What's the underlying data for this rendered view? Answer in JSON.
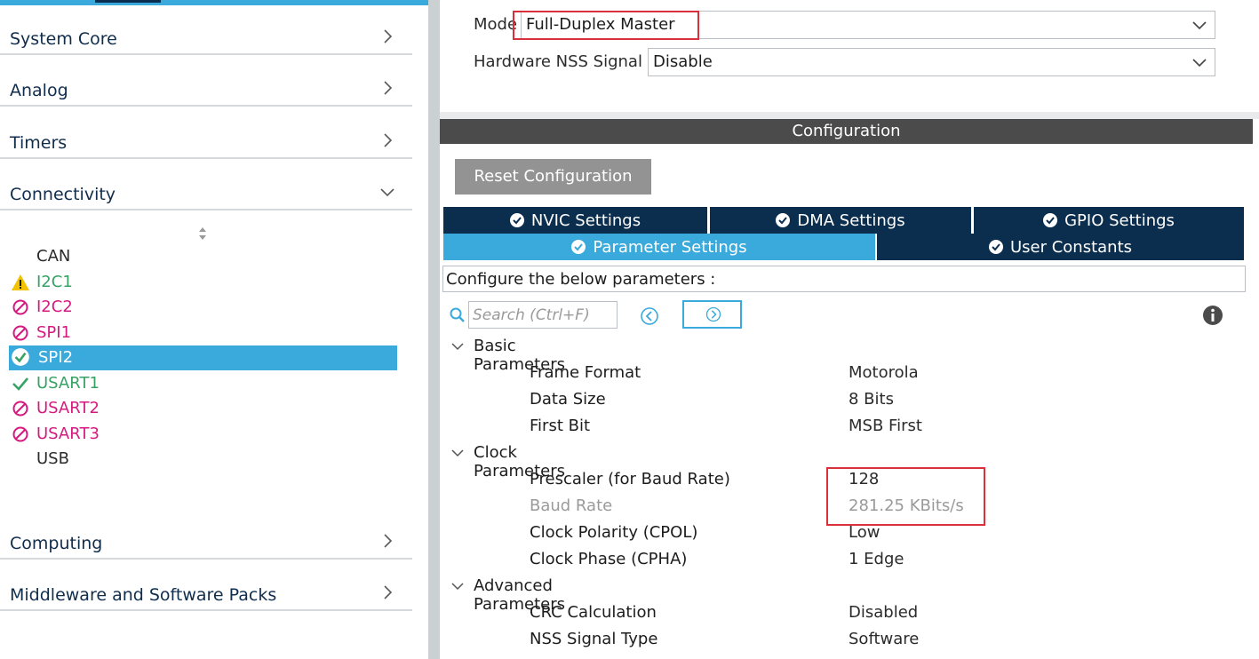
{
  "sidebar": {
    "categories": [
      {
        "label": "System Core"
      },
      {
        "label": "Analog"
      },
      {
        "label": "Timers"
      },
      {
        "label": "Connectivity"
      },
      {
        "label": "Computing"
      },
      {
        "label": "Middleware and Software Packs"
      }
    ],
    "peripherals": [
      {
        "label": "CAN",
        "status": "none"
      },
      {
        "label": "I2C1",
        "status": "warning"
      },
      {
        "label": "I2C2",
        "status": "disabled"
      },
      {
        "label": "SPI1",
        "status": "disabled"
      },
      {
        "label": "SPI2",
        "status": "selected"
      },
      {
        "label": "USART1",
        "status": "ok"
      },
      {
        "label": "USART2",
        "status": "disabled"
      },
      {
        "label": "USART3",
        "status": "disabled"
      },
      {
        "label": "USB",
        "status": "none"
      }
    ]
  },
  "mode": {
    "mode_label": "Mode",
    "mode_value": "Full-Duplex Master",
    "nss_label": "Hardware NSS Signal",
    "nss_value": "Disable"
  },
  "configuration": {
    "header": "Configuration",
    "reset_label": "Reset Configuration",
    "tabs": [
      {
        "label": "NVIC Settings",
        "active": false
      },
      {
        "label": "DMA Settings",
        "active": false
      },
      {
        "label": "GPIO Settings",
        "active": false
      },
      {
        "label": "Parameter Settings",
        "active": true
      },
      {
        "label": "User Constants",
        "active": false
      }
    ],
    "caption": "Configure the below parameters :",
    "search_placeholder": "Search (Ctrl+F)"
  },
  "parameters": {
    "groups": [
      {
        "label": "Basic Parameters"
      },
      {
        "label": "Clock Parameters"
      },
      {
        "label": "Advanced Parameters"
      }
    ],
    "rows": [
      {
        "name": "Frame Format",
        "value": "Motorola"
      },
      {
        "name": "Data Size",
        "value": "8 Bits"
      },
      {
        "name": "First Bit",
        "value": "MSB First"
      },
      {
        "name": "Prescaler (for Baud Rate)",
        "value": "128"
      },
      {
        "name": "Baud Rate",
        "value": "281.25 KBits/s"
      },
      {
        "name": "Clock Polarity (CPOL)",
        "value": "Low"
      },
      {
        "name": "Clock Phase (CPHA)",
        "value": "1 Edge"
      },
      {
        "name": "CRC Calculation",
        "value": "Disabled"
      },
      {
        "name": "NSS Signal Type",
        "value": "Software"
      }
    ]
  },
  "colors": {
    "accent": "#3aa9db",
    "navy": "#0b2e4e",
    "ok_green": "#38a265",
    "disabled_pink": "#d51a7f",
    "warning_yellow": "#f2c200",
    "highlight_red": "#d9303c"
  }
}
